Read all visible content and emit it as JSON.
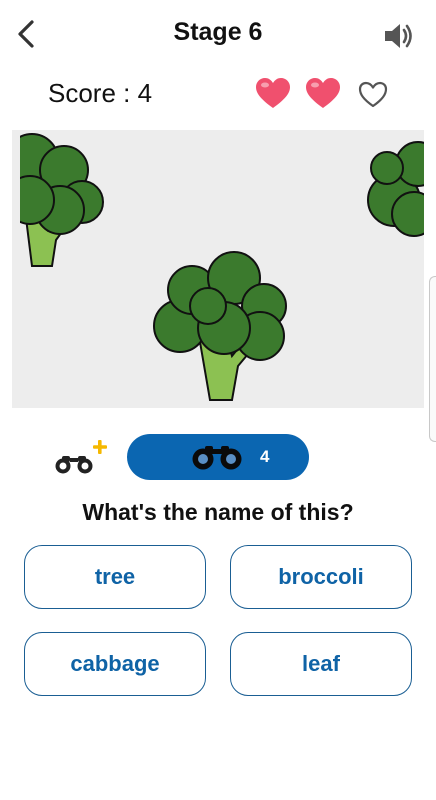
{
  "header": {
    "title": "Stage 6",
    "back_icon": "chevron-left-icon",
    "sound_icon": "speaker-icon"
  },
  "status": {
    "score_label": "Score : 4",
    "lives_total": 3,
    "lives_remaining": 2,
    "heart_full_color": "#f0506e",
    "heart_empty_color": "#555555"
  },
  "image": {
    "subject_icon": "broccoli-icon",
    "background_color": "#ededed",
    "broccoli_color": "#3b7a2d",
    "stem_color": "#8cc152"
  },
  "hint": {
    "add_hint_icon": "binoculars-plus-icon",
    "pill_icon": "binoculars-icon",
    "count": "4",
    "pill_color": "#0b66b1",
    "plus_color": "#f5b800"
  },
  "question": "What's the name of this?",
  "answers": [
    "tree",
    "broccoli",
    "cabbage",
    "leaf"
  ],
  "colors": {
    "answer_text": "#0f63a6",
    "answer_border": "#1a5e93"
  }
}
